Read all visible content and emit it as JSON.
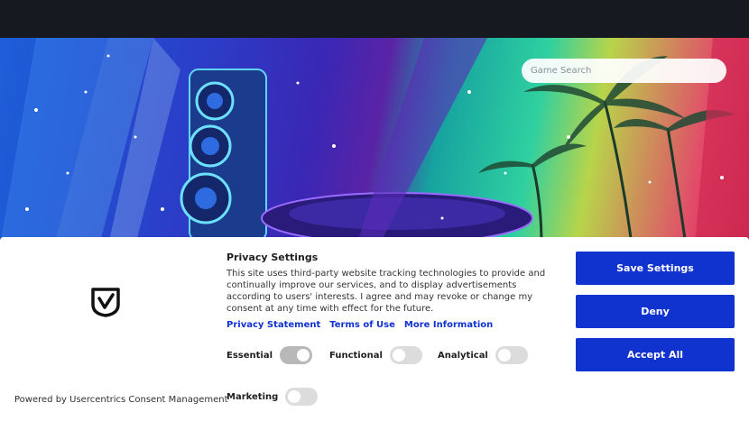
{
  "search": {
    "placeholder": "Game Search"
  },
  "consent": {
    "title": "Privacy Settings",
    "description": "This site uses third-party website tracking technologies to provide and continually improve our services, and to display advertisements according to users' interests. I agree and may revoke or change my consent at any time with effect for the future.",
    "links": {
      "privacy_statement": "Privacy Statement",
      "terms_of_use": "Terms of Use",
      "more_information": "More Information"
    },
    "toggles": {
      "essential": "Essential",
      "functional": "Functional",
      "analytical": "Analytical",
      "marketing": "Marketing"
    },
    "buttons": {
      "save_settings": "Save Settings",
      "deny": "Deny",
      "accept_all": "Accept All"
    },
    "powered_by": "Powered by Usercentrics Consent Management"
  },
  "colors": {
    "accent": "#1032cf",
    "topbar": "#16191f"
  },
  "icons": {
    "logo": "usercentrics-shield-check-icon"
  }
}
